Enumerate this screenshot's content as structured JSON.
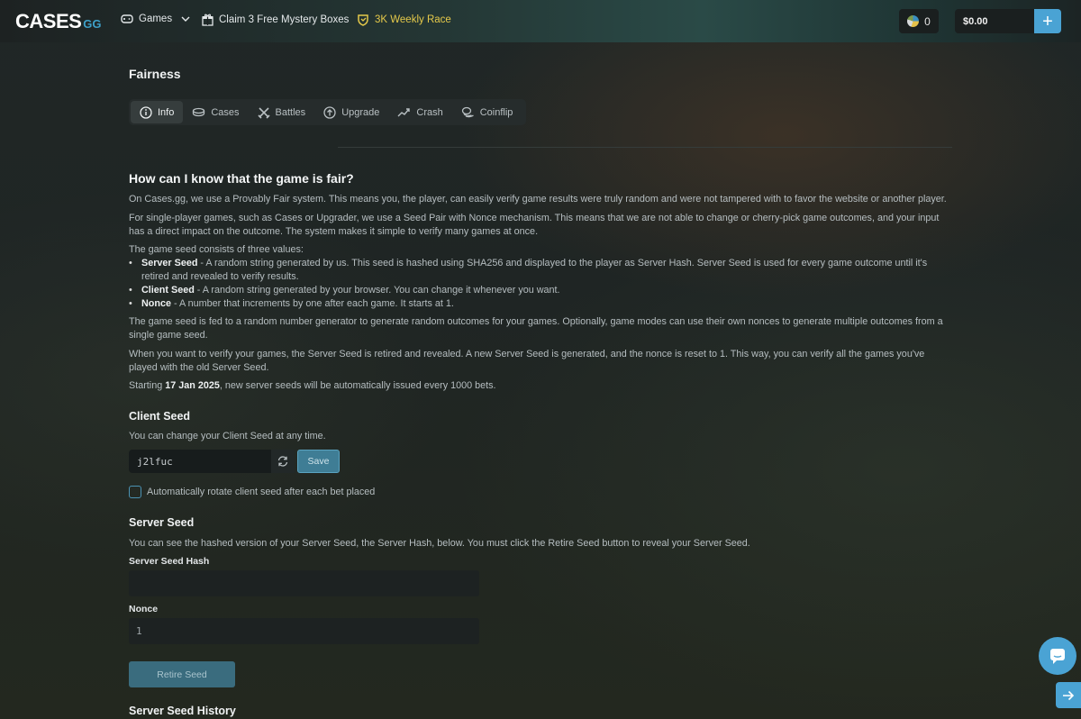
{
  "header": {
    "logo_main": "CASES",
    "logo_suffix": "GG",
    "nav": {
      "games": "Games",
      "mystery_boxes": "Claim 3 Free Mystery Boxes",
      "weekly_race": "3K Weekly Race"
    },
    "coins_count": "0",
    "balance": "$0.00",
    "deposit_symbol": "+"
  },
  "page": {
    "title": "Fairness",
    "tabs": [
      {
        "label": "Info",
        "icon": "info-icon"
      },
      {
        "label": "Cases",
        "icon": "cases-icon"
      },
      {
        "label": "Battles",
        "icon": "swords-icon"
      },
      {
        "label": "Upgrade",
        "icon": "arrow-up-circle-icon"
      },
      {
        "label": "Crash",
        "icon": "trend-up-icon"
      },
      {
        "label": "Coinflip",
        "icon": "coins-icon"
      }
    ],
    "active_tab": "Info"
  },
  "info": {
    "heading": "How can I know that the game is fair?",
    "p1": "On Cases.gg, we use a Provably Fair system. This means you, the player, can easily verify game results were truly random and were not tampered with to favor the website or another player.",
    "p2": "For single-player games, such as Cases or Upgrader, we use a Seed Pair with Nonce mechanism. This means that we are not able to change or cherry-pick game outcomes, and your input has a direct impact on the outcome. The system makes it simple to verify many games at once.",
    "p3": "The game seed consists of three values:",
    "bullets": [
      {
        "term": "Server Seed",
        "text": " - A random string generated by us. This seed is hashed using SHA256 and displayed to the player as Server Hash. Server Seed is used for every game outcome until it's retired and revealed to verify results."
      },
      {
        "term": "Client Seed",
        "text": " - A random string generated by your browser. You can change it whenever you want."
      },
      {
        "term": "Nonce",
        "text": " - A number that increments by one after each game. It starts at 1."
      }
    ],
    "p4": "The game seed is fed to a random number generator to generate random outcomes for your games. Optionally, game modes can use their own nonces to generate multiple outcomes from a single game seed.",
    "p5": "When you want to verify your games, the Server Seed is retired and revealed. A new Server Seed is generated, and the nonce is reset to 1. This way, you can verify all the games you've played with the old Server Seed.",
    "p6_prefix": "Starting ",
    "p6_date": "17 Jan 2025",
    "p6_suffix": ", new server seeds will be automatically issued every 1000 bets."
  },
  "client_seed": {
    "heading": "Client Seed",
    "description": "You can change your Client Seed at any time.",
    "value": "j2lfuc",
    "save_label": "Save",
    "auto_rotate_label": "Automatically rotate client seed after each bet placed"
  },
  "server_seed": {
    "heading": "Server Seed",
    "description": "You can see the hashed version of your Server Seed, the Server Hash, below. You must click the Retire Seed button to reveal your Server Seed.",
    "hash_label": "Server Seed Hash",
    "hash_value": "",
    "nonce_label": "Nonce",
    "nonce_value": "1",
    "retire_label": "Retire Seed"
  },
  "history": {
    "heading": "Server Seed History"
  },
  "colors": {
    "accent": "#4aa3d4",
    "race": "#e5c94a",
    "background": "#1f2524"
  }
}
